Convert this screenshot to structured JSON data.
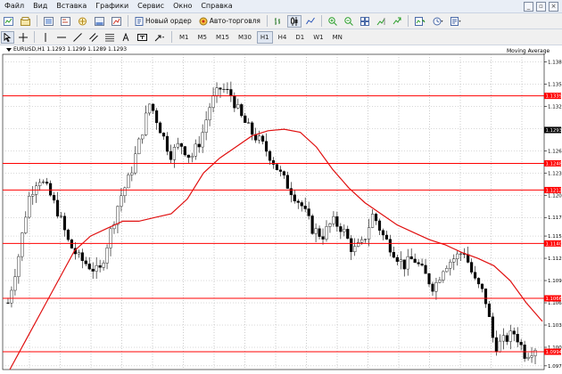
{
  "menu": [
    "Файл",
    "Вид",
    "Вставка",
    "Графики",
    "Сервис",
    "Окно",
    "Справка"
  ],
  "toolbar": {
    "new_order_label": "Новый ордер",
    "auto_trading_label": "Авто-торговля",
    "timeframes": [
      "M1",
      "M5",
      "M15",
      "M30",
      "H1",
      "H4",
      "D1",
      "W1",
      "MN"
    ],
    "active_timeframe": "H1"
  },
  "chart": {
    "symbol_label": "EURUSD,H1  1.1293 1.1299 1.1289 1.1293",
    "indicator_label": "Moving Average",
    "current_price": "1.1293",
    "colors": {
      "level_line": "#ff0000",
      "ma_line": "#e01010",
      "candle": "#000000",
      "price_tag": "#ff0000",
      "current_tag": "#000000"
    }
  },
  "chart_data": {
    "type": "candlestick",
    "y_axis_ticks": [
      "1.1385",
      "1.1355",
      "1.1325",
      "1.1295",
      "1.1265",
      "1.1235",
      "1.1205",
      "1.1175",
      "1.1150",
      "1.1120",
      "1.1090",
      "1.1060",
      "1.1030",
      "1.1000",
      "1.0975"
    ],
    "ylim": [
      1.097,
      1.1395
    ],
    "horizontal_levels": [
      {
        "value": 1.1339,
        "label": "1.1339"
      },
      {
        "value": 1.1248,
        "label": "1.1248"
      },
      {
        "value": 1.1212,
        "label": "1.1212"
      },
      {
        "value": 1.114,
        "label": "1.1140"
      },
      {
        "value": 1.1066,
        "label": "1.1066"
      },
      {
        "value": 1.0994,
        "label": "1.0994"
      }
    ],
    "moving_average": [
      1.097,
      1.101,
      1.105,
      1.109,
      1.113,
      1.115,
      1.116,
      1.117,
      1.117,
      1.1175,
      1.118,
      1.12,
      1.1235,
      1.1255,
      1.127,
      1.1285,
      1.1292,
      1.1294,
      1.129,
      1.127,
      1.124,
      1.1215,
      1.1195,
      1.118,
      1.1165,
      1.1155,
      1.1145,
      1.1138,
      1.1128,
      1.112,
      1.111,
      1.109,
      1.106,
      1.1035
    ],
    "close_path": [
      1.106,
      1.112,
      1.12,
      1.123,
      1.121,
      1.118,
      1.114,
      1.112,
      1.111,
      1.11,
      1.115,
      1.12,
      1.123,
      1.128,
      1.133,
      1.1295,
      1.126,
      1.1275,
      1.1255,
      1.128,
      1.133,
      1.135,
      1.134,
      1.131,
      1.129,
      1.1275,
      1.1255,
      1.123,
      1.121,
      1.119,
      1.116,
      1.115,
      1.117,
      1.116,
      1.113,
      1.114,
      1.118,
      1.115,
      1.113,
      1.111,
      1.112,
      1.11,
      1.108,
      1.111,
      1.112,
      1.113,
      1.109,
      1.107,
      1.1,
      1.101,
      1.102,
      1.099,
      1.1
    ]
  }
}
